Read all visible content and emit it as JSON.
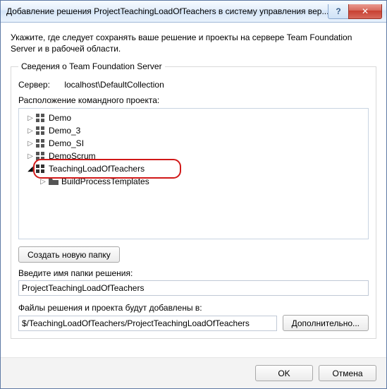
{
  "title": "Добавление решения ProjectTeachingLoadOfTeachers в систему управления вер...",
  "help_glyph": "?",
  "close_glyph": "✕",
  "intro": "Укажите, где следует сохранять ваше решение и проекты на сервере Team Foundation Server и в рабочей области.",
  "group": {
    "legend": "Сведения о Team Foundation Server",
    "server_label": "Сервер:",
    "server_value": "localhost\\DefaultCollection",
    "tree_label": "Расположение командного проекта:",
    "items": [
      {
        "label": "Demo",
        "expanded": false,
        "selected": false,
        "type": "project"
      },
      {
        "label": "Demo_3",
        "expanded": false,
        "selected": false,
        "type": "project"
      },
      {
        "label": "Demo_SI",
        "expanded": false,
        "selected": false,
        "type": "project"
      },
      {
        "label": "DemoScrum",
        "expanded": false,
        "selected": false,
        "type": "project"
      },
      {
        "label": "TeachingLoadOfTeachers",
        "expanded": true,
        "selected": true,
        "type": "project"
      }
    ],
    "child": {
      "label": "BuildProcessTemplates",
      "type": "folder"
    },
    "new_folder_btn": "Создать новую папку"
  },
  "solution_folder": {
    "label": "Введите имя папки решения:",
    "value": "ProjectTeachingLoadOfTeachers"
  },
  "files_path": {
    "label": "Файлы решения и проекта будут добавлены в:",
    "value": "$/TeachingLoadOfTeachers/ProjectTeachingLoadOfTeachers",
    "advanced_btn": "Дополнительно..."
  },
  "footer": {
    "ok": "OK",
    "cancel": "Отмена"
  }
}
